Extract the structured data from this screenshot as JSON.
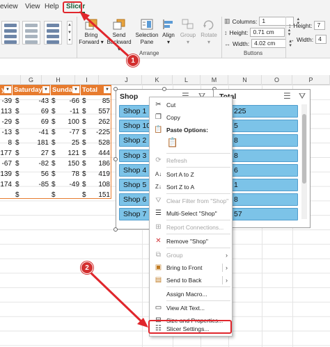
{
  "ribbon": {
    "tabs": [
      "eview",
      "View",
      "Help",
      "Slicer"
    ],
    "active_tab": "Slicer",
    "arrange": {
      "label": "Arrange",
      "bring_forward": "Bring Forward",
      "send_backward": "Send Backward",
      "selection_pane": "Selection Pane",
      "align": "Align",
      "group": "Group",
      "rotate": "Rotate"
    },
    "buttons": {
      "label": "Buttons",
      "columns_label": "Columns:",
      "columns_value": "1",
      "height_label": "Height:",
      "height_value": "0.71 cm",
      "width_label": "Width:",
      "width_value": "4.02 cm"
    },
    "size": {
      "height_label": "Height:",
      "height_value": "7",
      "width_label": "Width:",
      "width_value": "4"
    }
  },
  "sheet": {
    "columns": [
      "G",
      "H",
      "I",
      "J",
      "K",
      "L",
      "M",
      "N",
      "O",
      "P"
    ],
    "table_headers": [
      "y",
      "Saturday",
      "Sunday",
      "Total"
    ],
    "rows": [
      [
        "-39",
        "$",
        "-43",
        "$",
        "-66",
        "$",
        "85"
      ],
      [
        "113",
        "$",
        "69",
        "$",
        "-11",
        "$",
        "557"
      ],
      [
        "-29",
        "$",
        "69",
        "$",
        "100",
        "$",
        "262"
      ],
      [
        "-13",
        "$",
        "-41",
        "$",
        "-77",
        "$",
        "-225"
      ],
      [
        "8",
        "$",
        "181",
        "$",
        "25",
        "$",
        "528"
      ],
      [
        "177",
        "$",
        "27",
        "$",
        "121",
        "$",
        "444"
      ],
      [
        "-67",
        "$",
        "-82",
        "$",
        "150",
        "$",
        "186"
      ],
      [
        "139",
        "$",
        "56",
        "$",
        "78",
        "$",
        "419"
      ],
      [
        "174",
        "$",
        "-85",
        "$",
        "-49",
        "$",
        "108"
      ],
      [
        "",
        "$",
        "",
        "$",
        "",
        "$",
        "151"
      ]
    ]
  },
  "slicer_shop": {
    "title": "Shop",
    "items": [
      "Shop 1",
      "Shop 10",
      "Shop 2",
      "Shop 3",
      "Shop 4",
      "Shop 5",
      "Shop 6",
      "Shop 7"
    ]
  },
  "slicer_total": {
    "title": "Total",
    "items": [
      "225",
      "5",
      "8",
      "8",
      "6",
      "1",
      "8",
      "57"
    ]
  },
  "context_menu": {
    "cut": "Cut",
    "copy": "Copy",
    "paste_options": "Paste Options:",
    "refresh": "Refresh",
    "sort_az": "Sort A to Z",
    "sort_za": "Sort Z to A",
    "clear_filter": "Clear Filter from \"Shop\"",
    "multi_select": "Multi-Select \"Shop\"",
    "report_connections": "Report Connections...",
    "remove": "Remove \"Shop\"",
    "group": "Group",
    "bring_to_front": "Bring to Front",
    "send_to_back": "Send to Back",
    "assign_macro": "Assign Macro...",
    "view_alt_text": "View Alt Text...",
    "size_properties": "Size and Properties...",
    "slicer_settings": "Slicer Settings..."
  },
  "annotations": {
    "step1": "1",
    "step2": "2",
    "color": "#e0262c"
  },
  "colors": {
    "table_header": "#e77b2e",
    "slicer_item": "#7cc3e8",
    "excel_green": "#185c37"
  }
}
